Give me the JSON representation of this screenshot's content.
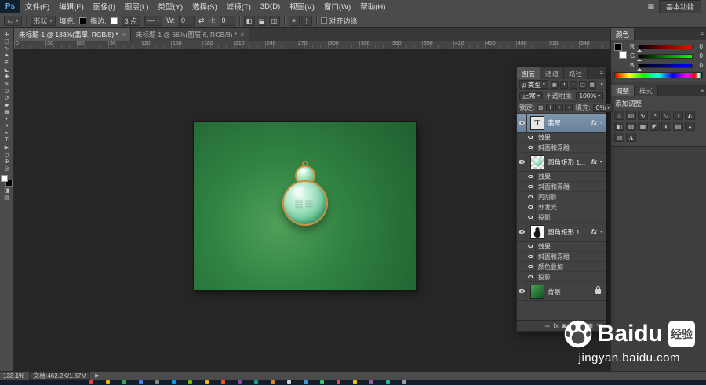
{
  "app": {
    "logo": "Ps",
    "workspace": "基本功能",
    "grid_icon": "▦"
  },
  "menu_bar": {
    "items": [
      "文件(F)",
      "编辑(E)",
      "图像(I)",
      "图层(L)",
      "类型(Y)",
      "选择(S)",
      "滤镜(T)",
      "3D(D)",
      "视图(V)",
      "窗口(W)",
      "帮助(H)"
    ]
  },
  "options_bar": {
    "preset_glyph": "▭",
    "mode": "形状",
    "fill_label": "填充:",
    "stroke_label": "描边:",
    "stroke_width": "3 点",
    "line_glyph": "—",
    "w_label": "W:",
    "w_value": "0",
    "link_glyph": "⇄",
    "h_label": "H:",
    "h_value": "0",
    "path_ops": [
      "◧",
      "⬓",
      "◫"
    ],
    "arrange_icons": [
      "≡",
      "⋮"
    ],
    "align_edges": "对齐边缘"
  },
  "document_tabs": [
    {
      "label": "未标题-1 @ 133%(翡翠, RGB/8) *",
      "close": "×",
      "active": true
    },
    {
      "label": "未标题-1 @ 66%(图层 6, RGB/8) *",
      "close": "×",
      "active": false
    }
  ],
  "ruler": {
    "labels": [
      "0",
      "30",
      "60",
      "90",
      "120",
      "150",
      "180",
      "210",
      "240",
      "270",
      "300",
      "330",
      "360",
      "390",
      "420",
      "450",
      "480",
      "510",
      "540"
    ]
  },
  "toolbar": {
    "tools": [
      {
        "name": "move-tool",
        "glyph": "✛"
      },
      {
        "name": "marquee-tool",
        "glyph": "▢"
      },
      {
        "name": "lasso-tool",
        "glyph": "∿"
      },
      {
        "name": "quick-selection-tool",
        "glyph": "✦"
      },
      {
        "name": "crop-tool",
        "glyph": "#"
      },
      {
        "name": "eyedropper-tool",
        "glyph": "◣"
      },
      {
        "name": "healing-brush-tool",
        "glyph": "✚"
      },
      {
        "name": "brush-tool",
        "glyph": "✎"
      },
      {
        "name": "clone-stamp-tool",
        "glyph": "⊙"
      },
      {
        "name": "history-brush-tool",
        "glyph": "↺"
      },
      {
        "name": "eraser-tool",
        "glyph": "▰"
      },
      {
        "name": "gradient-tool",
        "glyph": "▩"
      },
      {
        "name": "blur-tool",
        "glyph": "◗"
      },
      {
        "name": "dodge-tool",
        "glyph": "◑"
      },
      {
        "name": "pen-tool",
        "glyph": "✒"
      },
      {
        "name": "type-tool",
        "glyph": "T"
      },
      {
        "name": "path-selection-tool",
        "glyph": "▶"
      },
      {
        "name": "shape-tool",
        "glyph": "◻"
      },
      {
        "name": "hand-tool",
        "glyph": "✣"
      },
      {
        "name": "zoom-tool",
        "glyph": "◎"
      }
    ]
  },
  "canvas": {
    "pendant_text": "翡翠"
  },
  "layers_panel": {
    "tabs": [
      "图层",
      "通道",
      "路径"
    ],
    "menu_icon": "≡",
    "filter": {
      "search_glyph": "ρ",
      "kind_label": "类型",
      "caret": "▾",
      "icons": [
        "▣",
        "◑",
        "T",
        "▢",
        "▦"
      ],
      "toggle": "●"
    },
    "blend": {
      "mode": "正常",
      "caret": "▾",
      "opacity_label": "不透明度:",
      "opacity_value": "100%"
    },
    "lock": {
      "label": "锁定:",
      "icons": [
        "▨",
        "✛",
        "+",
        "▪"
      ],
      "fill_label": "填充:",
      "fill_value": "0%"
    },
    "fx_badge": "fx",
    "collapse_glyph": "▾",
    "text_thumb_glyph": "T",
    "rows": [
      {
        "kind": "layer",
        "selected": true,
        "thumb": "text",
        "name": "翡翠",
        "fx": true
      },
      {
        "kind": "fxheader",
        "name": "效果"
      },
      {
        "kind": "fx",
        "name": "斜面和浮雕"
      },
      {
        "kind": "layer",
        "thumb": "dot",
        "name": "圆角矩形 1...",
        "fx": true
      },
      {
        "kind": "fxheader",
        "name": "效果"
      },
      {
        "kind": "fx",
        "name": "斜面和浮雕"
      },
      {
        "kind": "fx",
        "name": "内阴影"
      },
      {
        "kind": "fx",
        "name": "外发光"
      },
      {
        "kind": "fx",
        "name": "投影"
      },
      {
        "kind": "layer",
        "thumb": "gourd",
        "name": "圆角矩形 1",
        "fx": true
      },
      {
        "kind": "fxheader",
        "name": "效果"
      },
      {
        "kind": "fx",
        "name": "斜面和浮雕"
      },
      {
        "kind": "fx",
        "name": "颜色叠加"
      },
      {
        "kind": "fx",
        "name": "投影"
      },
      {
        "kind": "layer",
        "thumb": "bg",
        "name": "背景",
        "locked": true
      }
    ],
    "bottom_icons": [
      {
        "name": "link-layers-icon",
        "glyph": "∞"
      },
      {
        "name": "layer-style-icon",
        "glyph": "fx"
      },
      {
        "name": "layer-mask-icon",
        "glyph": "◙"
      },
      {
        "name": "adjustment-layer-icon",
        "glyph": "◑"
      },
      {
        "name": "layer-group-icon",
        "glyph": "▢"
      },
      {
        "name": "new-layer-icon",
        "glyph": "⊞"
      },
      {
        "name": "delete-layer-icon",
        "glyph": "▽"
      }
    ]
  },
  "color_panel": {
    "tab": "颜色",
    "menu_icon": "≡",
    "channels": [
      {
        "label": "R",
        "value": "0",
        "track": "red"
      },
      {
        "label": "G",
        "value": "0",
        "track": "green"
      },
      {
        "label": "B",
        "value": "0",
        "track": "blue"
      }
    ]
  },
  "adjustments_panel": {
    "tabs": [
      "调整",
      "样式"
    ],
    "title": "添加调整",
    "icons": [
      {
        "name": "brightness-contrast-icon",
        "glyph": "☼"
      },
      {
        "name": "levels-icon",
        "glyph": "▥"
      },
      {
        "name": "curves-icon",
        "glyph": "∿"
      },
      {
        "name": "exposure-icon",
        "glyph": "◔"
      },
      {
        "name": "vibrance-icon",
        "glyph": "▽"
      },
      {
        "name": "hue-saturation-icon",
        "glyph": "◑"
      },
      {
        "name": "color-balance-icon",
        "glyph": "◭"
      },
      {
        "name": "black-white-icon",
        "glyph": "◧"
      },
      {
        "name": "photo-filter-icon",
        "glyph": "◍"
      },
      {
        "name": "channel-mixer-icon",
        "glyph": "▦"
      },
      {
        "name": "color-lookup-icon",
        "glyph": "◩"
      },
      {
        "name": "invert-icon",
        "glyph": "◐"
      },
      {
        "name": "posterize-icon",
        "glyph": "▤"
      },
      {
        "name": "threshold-icon",
        "glyph": "◒"
      },
      {
        "name": "gradient-map-icon",
        "glyph": "▧"
      },
      {
        "name": "selective-color-icon",
        "glyph": "◮"
      }
    ]
  },
  "status_bar": {
    "zoom": "133.1%",
    "doc_info": "文档:462.2K/1.37M",
    "arrow": "▶"
  },
  "watermark": {
    "brand": "Baidu",
    "badge": "经验",
    "url": "jingyan.baidu.com"
  },
  "taskbar": {
    "colors": [
      "#e8453c",
      "#f5b400",
      "#34a853",
      "#4285f4",
      "#8a8a8a",
      "#00a1f1",
      "#7cbb00",
      "#ffbb00",
      "#f65314",
      "#8e44ad",
      "#16a085",
      "#e67e22",
      "#d0d3d4",
      "#3498db",
      "#2ecc71",
      "#e74c3c",
      "#f1c40f",
      "#9b59b6",
      "#1abc9c",
      "#95a5a6"
    ]
  }
}
